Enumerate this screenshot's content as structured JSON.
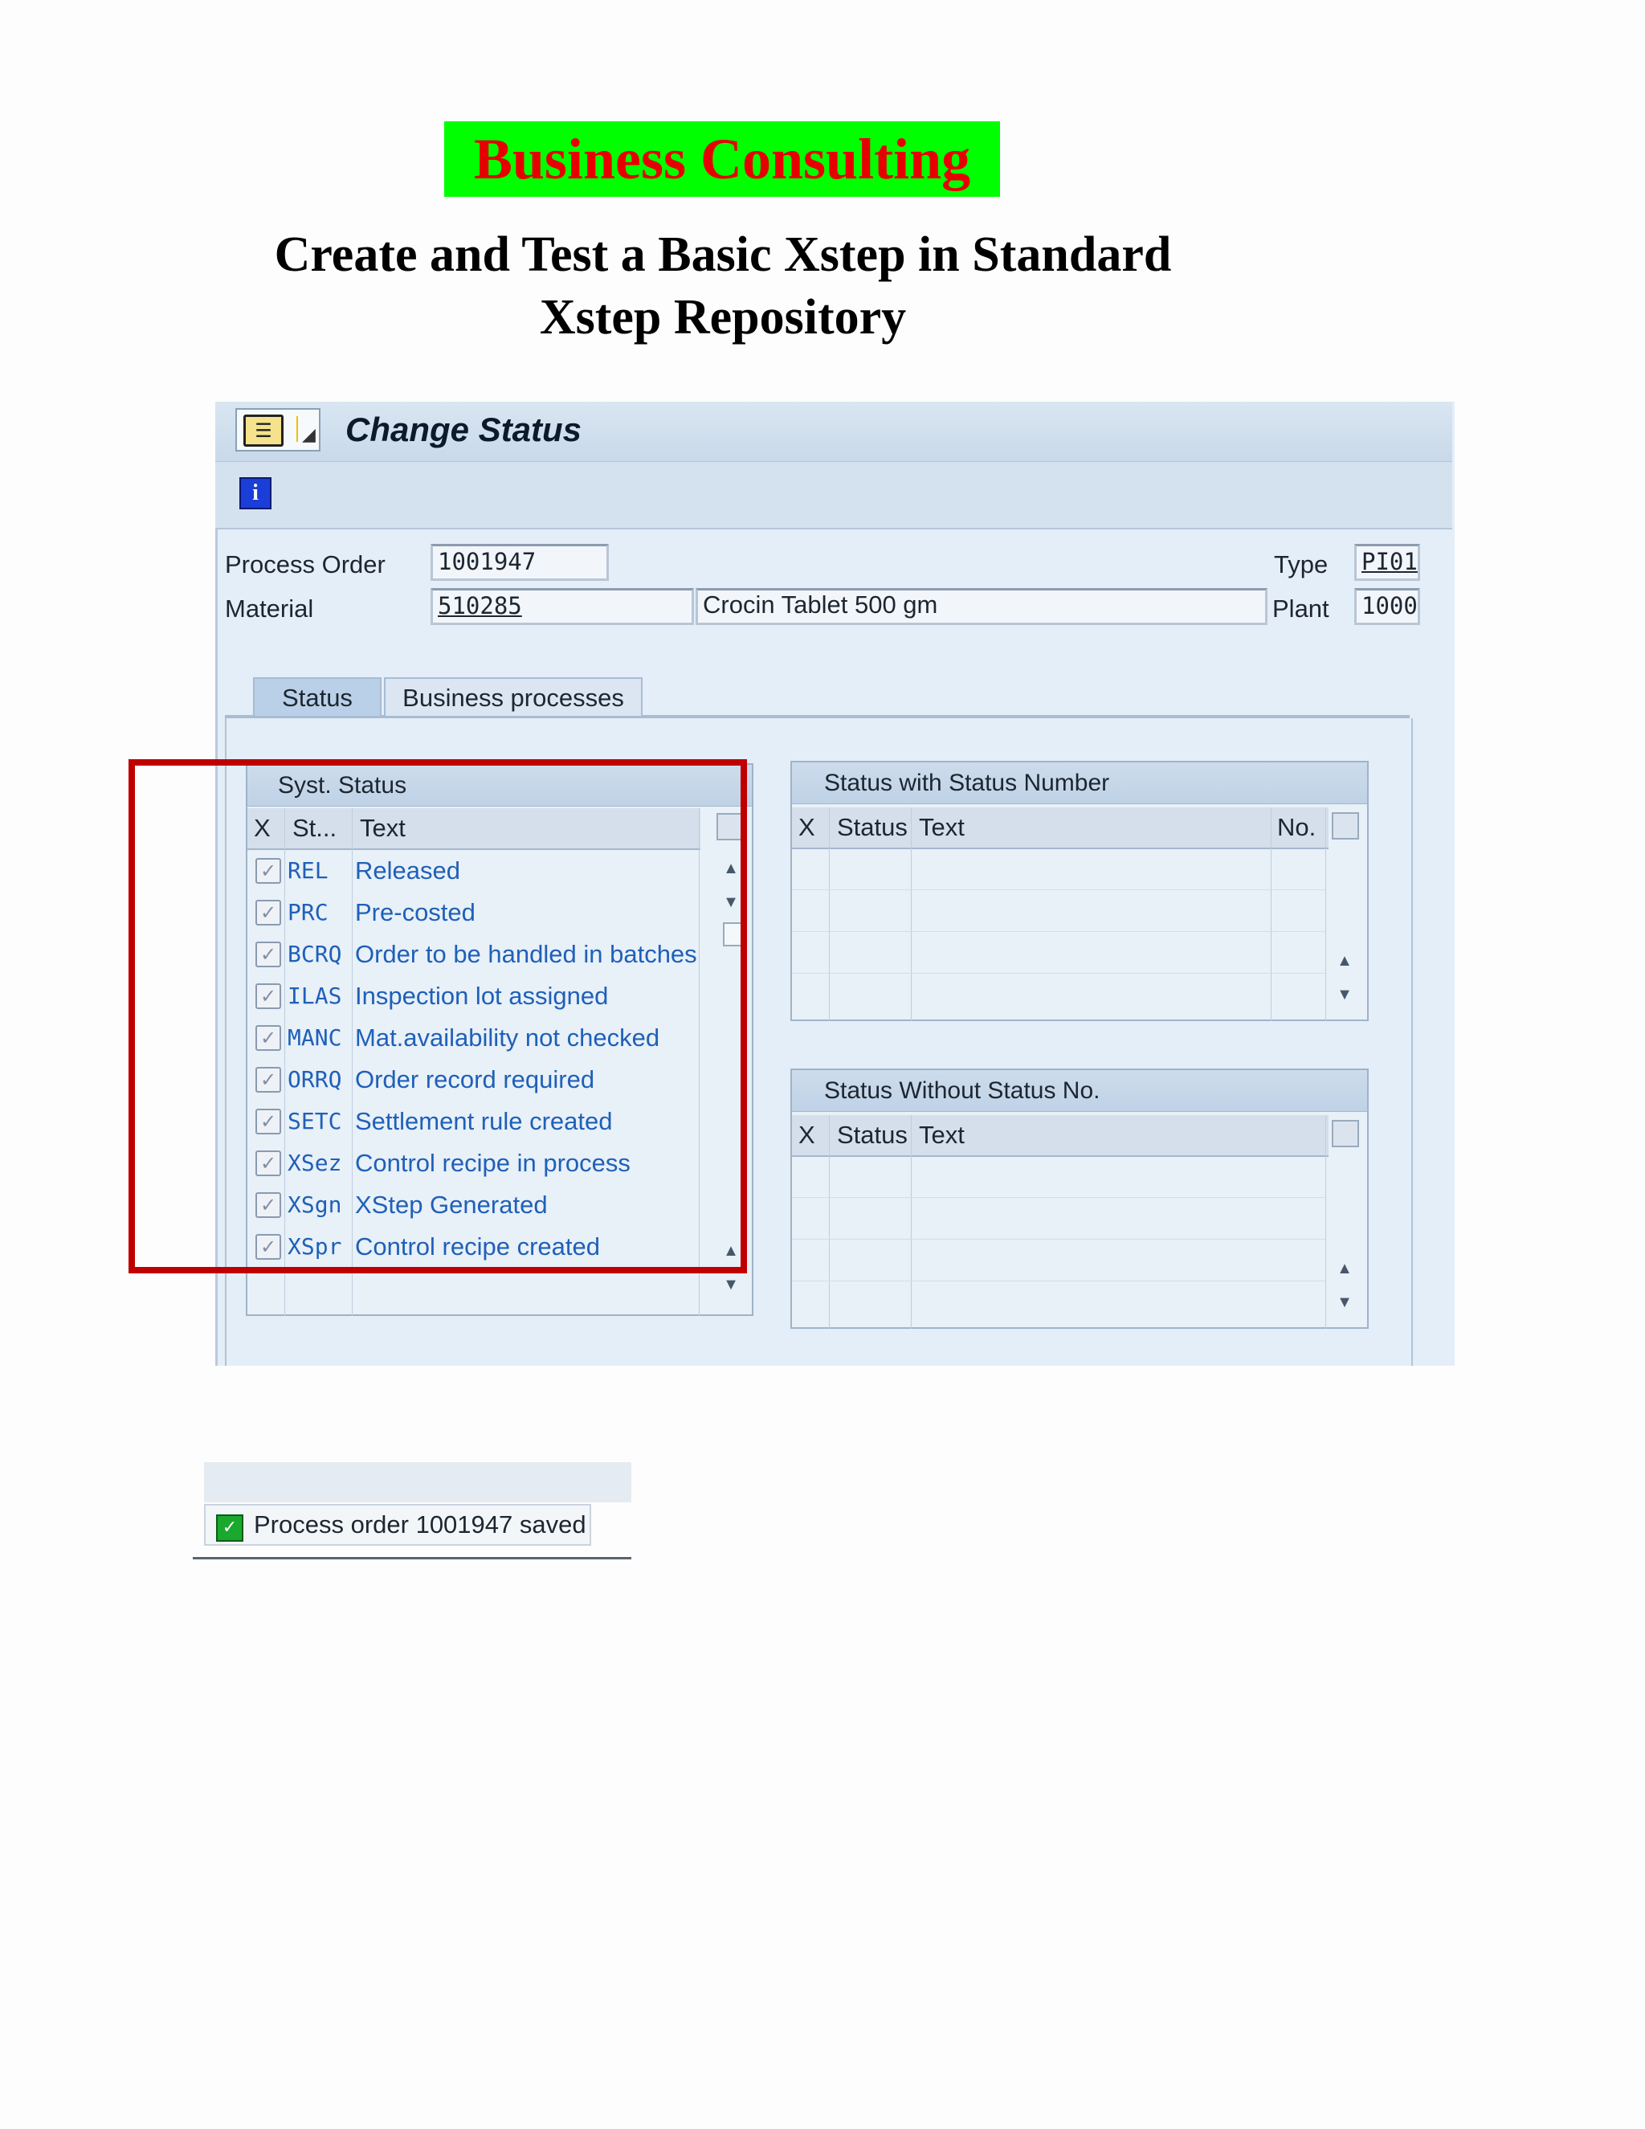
{
  "brand": "Business Consulting",
  "doc_title_line1": "Create and Test a Basic Xstep in Standard",
  "doc_title_line2": "Xstep Repository",
  "screen": {
    "title": "Change Status",
    "info_icon": "i",
    "menu_icon": "screen-menu-icon"
  },
  "header": {
    "process_order_label": "Process Order",
    "process_order_value": "1001947",
    "material_label": "Material",
    "material_value": "510285",
    "material_desc": "Crocin Tablet 500 gm",
    "type_label": "Type",
    "type_value": "PI01",
    "plant_label": "Plant",
    "plant_value": "1000"
  },
  "tabs": [
    "Status",
    "Business processes"
  ],
  "syst_status": {
    "title": "Syst. Status",
    "columns": [
      "X",
      "St...",
      "Text"
    ],
    "rows": [
      {
        "code": "REL",
        "text": "Released"
      },
      {
        "code": "PRC",
        "text": "Pre-costed"
      },
      {
        "code": "BCRQ",
        "text": "Order to be handled in batches"
      },
      {
        "code": "ILAS",
        "text": "Inspection lot assigned"
      },
      {
        "code": "MANC",
        "text": "Mat.availability not checked"
      },
      {
        "code": "ORRQ",
        "text": "Order record required"
      },
      {
        "code": "SETC",
        "text": "Settlement rule created"
      },
      {
        "code": "XSez",
        "text": "Control recipe in process"
      },
      {
        "code": "XSgn",
        "text": "XStep Generated"
      },
      {
        "code": "XSpr",
        "text": "Control recipe created"
      }
    ]
  },
  "status_with_number": {
    "title": "Status with Status Number",
    "columns": [
      "X",
      "Status",
      "Text",
      "No."
    ]
  },
  "status_without_number": {
    "title": "Status Without Status No.",
    "columns": [
      "X",
      "Status",
      "Text"
    ]
  },
  "message": "Process order 1001947 saved",
  "colors": {
    "brand_bg": "#00ff00",
    "brand_text": "#e60000",
    "highlight": "#c00000",
    "link_text": "#1f60b8"
  }
}
